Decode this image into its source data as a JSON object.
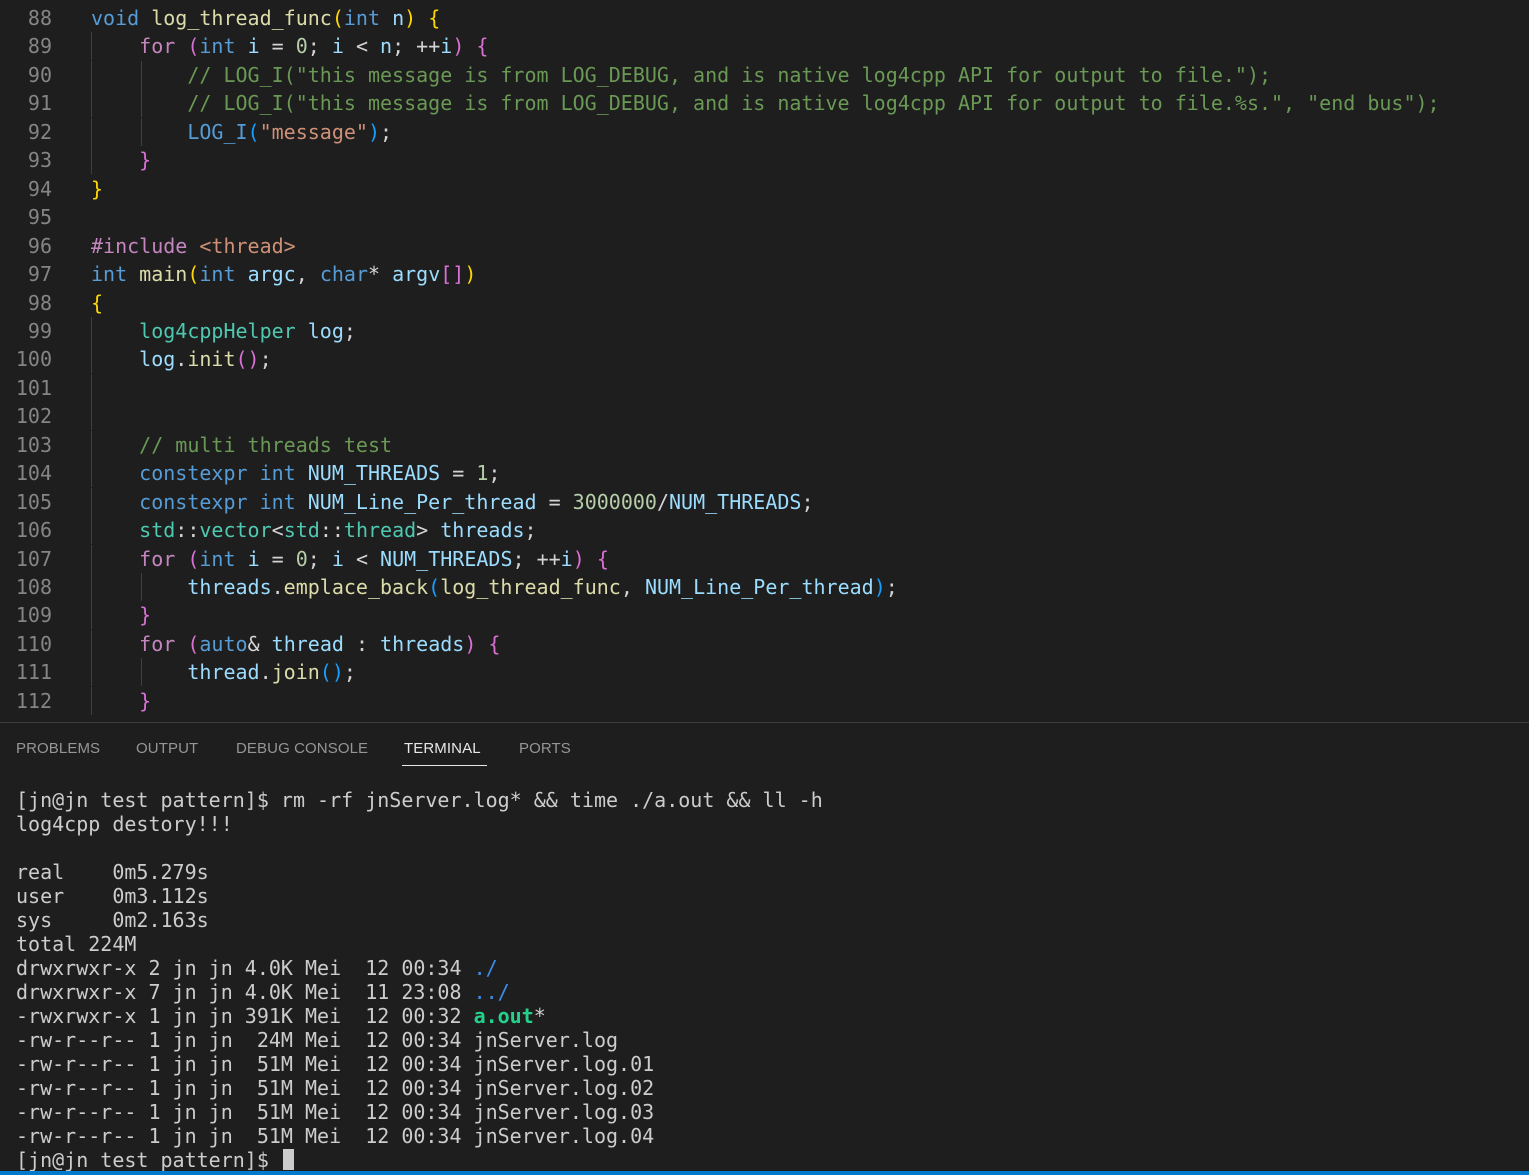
{
  "editor": {
    "lines": [
      {
        "num": "88",
        "guides": 0,
        "tokens": [
          [
            "kw",
            "void"
          ],
          [
            "op",
            " "
          ],
          [
            "fn",
            "log_thread_func"
          ],
          [
            "b1",
            "("
          ],
          [
            "kw",
            "int"
          ],
          [
            "op",
            " "
          ],
          [
            "var",
            "n"
          ],
          [
            "b1",
            ")"
          ],
          [
            "op",
            " "
          ],
          [
            "b1",
            "{"
          ]
        ]
      },
      {
        "num": "89",
        "guides": 1,
        "tokens": [
          [
            "op",
            "    "
          ],
          [
            "ctl",
            "for"
          ],
          [
            "op",
            " "
          ],
          [
            "b2",
            "("
          ],
          [
            "kw",
            "int"
          ],
          [
            "op",
            " "
          ],
          [
            "var",
            "i"
          ],
          [
            "op",
            " = "
          ],
          [
            "num",
            "0"
          ],
          [
            "op",
            "; "
          ],
          [
            "var",
            "i"
          ],
          [
            "op",
            " < "
          ],
          [
            "var",
            "n"
          ],
          [
            "op",
            "; ++"
          ],
          [
            "var",
            "i"
          ],
          [
            "b2",
            ")"
          ],
          [
            "op",
            " "
          ],
          [
            "b2",
            "{"
          ]
        ]
      },
      {
        "num": "90",
        "guides": 2,
        "tokens": [
          [
            "op",
            "        "
          ],
          [
            "cm",
            "// LOG_I(\"this message is from LOG_DEBUG, and is native log4cpp API for output to file.\");"
          ]
        ]
      },
      {
        "num": "91",
        "guides": 2,
        "tokens": [
          [
            "op",
            "        "
          ],
          [
            "cm",
            "// LOG_I(\"this message is from LOG_DEBUG, and is native log4cpp API for output to file.%s.\", \"end bus\");"
          ]
        ]
      },
      {
        "num": "92",
        "guides": 2,
        "tokens": [
          [
            "op",
            "        "
          ],
          [
            "kw",
            "LOG_I"
          ],
          [
            "b3",
            "("
          ],
          [
            "str",
            "\"message\""
          ],
          [
            "b3",
            ")"
          ],
          [
            "op",
            ";"
          ]
        ]
      },
      {
        "num": "93",
        "guides": 1,
        "tokens": [
          [
            "op",
            "    "
          ],
          [
            "b2",
            "}"
          ]
        ]
      },
      {
        "num": "94",
        "guides": 0,
        "tokens": [
          [
            "b1",
            "}"
          ]
        ]
      },
      {
        "num": "95",
        "guides": 0,
        "tokens": []
      },
      {
        "num": "96",
        "guides": 0,
        "tokens": [
          [
            "ctl",
            "#include"
          ],
          [
            "op",
            " "
          ],
          [
            "str",
            "<thread>"
          ]
        ]
      },
      {
        "num": "97",
        "guides": 0,
        "tokens": [
          [
            "kw",
            "int"
          ],
          [
            "op",
            " "
          ],
          [
            "fn",
            "main"
          ],
          [
            "b1",
            "("
          ],
          [
            "kw",
            "int"
          ],
          [
            "op",
            " "
          ],
          [
            "var",
            "argc"
          ],
          [
            "op",
            ", "
          ],
          [
            "kw",
            "char"
          ],
          [
            "op",
            "* "
          ],
          [
            "var",
            "argv"
          ],
          [
            "b2",
            "[]"
          ],
          [
            "b1",
            ")"
          ]
        ]
      },
      {
        "num": "98",
        "guides": 0,
        "tokens": [
          [
            "b1",
            "{"
          ]
        ]
      },
      {
        "num": "99",
        "guides": 1,
        "tokens": [
          [
            "op",
            "    "
          ],
          [
            "ty",
            "log4cppHelper"
          ],
          [
            "op",
            " "
          ],
          [
            "var",
            "log"
          ],
          [
            "op",
            ";"
          ]
        ]
      },
      {
        "num": "100",
        "guides": 1,
        "tokens": [
          [
            "op",
            "    "
          ],
          [
            "var",
            "log"
          ],
          [
            "op",
            "."
          ],
          [
            "fn",
            "init"
          ],
          [
            "b2",
            "()"
          ],
          [
            "op",
            ";"
          ]
        ]
      },
      {
        "num": "101",
        "guides": 1,
        "tokens": []
      },
      {
        "num": "102",
        "guides": 1,
        "tokens": []
      },
      {
        "num": "103",
        "guides": 1,
        "tokens": [
          [
            "op",
            "    "
          ],
          [
            "cm",
            "// multi threads test"
          ]
        ]
      },
      {
        "num": "104",
        "guides": 1,
        "tokens": [
          [
            "op",
            "    "
          ],
          [
            "kw",
            "constexpr"
          ],
          [
            "op",
            " "
          ],
          [
            "kw",
            "int"
          ],
          [
            "op",
            " "
          ],
          [
            "var",
            "NUM_THREADS"
          ],
          [
            "op",
            " = "
          ],
          [
            "num",
            "1"
          ],
          [
            "op",
            ";"
          ]
        ]
      },
      {
        "num": "105",
        "guides": 1,
        "tokens": [
          [
            "op",
            "    "
          ],
          [
            "kw",
            "constexpr"
          ],
          [
            "op",
            " "
          ],
          [
            "kw",
            "int"
          ],
          [
            "op",
            " "
          ],
          [
            "var",
            "NUM_Line_Per_thread"
          ],
          [
            "op",
            " = "
          ],
          [
            "num",
            "3000000"
          ],
          [
            "op",
            "/"
          ],
          [
            "var",
            "NUM_THREADS"
          ],
          [
            "op",
            ";"
          ]
        ]
      },
      {
        "num": "106",
        "guides": 1,
        "tokens": [
          [
            "op",
            "    "
          ],
          [
            "ty",
            "std"
          ],
          [
            "op",
            "::"
          ],
          [
            "ty",
            "vector"
          ],
          [
            "op",
            "<"
          ],
          [
            "ty",
            "std"
          ],
          [
            "op",
            "::"
          ],
          [
            "ty",
            "thread"
          ],
          [
            "op",
            "> "
          ],
          [
            "var",
            "threads"
          ],
          [
            "op",
            ";"
          ]
        ]
      },
      {
        "num": "107",
        "guides": 1,
        "tokens": [
          [
            "op",
            "    "
          ],
          [
            "ctl",
            "for"
          ],
          [
            "op",
            " "
          ],
          [
            "b2",
            "("
          ],
          [
            "kw",
            "int"
          ],
          [
            "op",
            " "
          ],
          [
            "var",
            "i"
          ],
          [
            "op",
            " = "
          ],
          [
            "num",
            "0"
          ],
          [
            "op",
            "; "
          ],
          [
            "var",
            "i"
          ],
          [
            "op",
            " < "
          ],
          [
            "var",
            "NUM_THREADS"
          ],
          [
            "op",
            "; ++"
          ],
          [
            "var",
            "i"
          ],
          [
            "b2",
            ")"
          ],
          [
            "op",
            " "
          ],
          [
            "b2",
            "{"
          ]
        ]
      },
      {
        "num": "108",
        "guides": 2,
        "tokens": [
          [
            "op",
            "        "
          ],
          [
            "var",
            "threads"
          ],
          [
            "op",
            "."
          ],
          [
            "fn",
            "emplace_back"
          ],
          [
            "b3",
            "("
          ],
          [
            "fn",
            "log_thread_func"
          ],
          [
            "op",
            ", "
          ],
          [
            "var",
            "NUM_Line_Per_thread"
          ],
          [
            "b3",
            ")"
          ],
          [
            "op",
            ";"
          ]
        ]
      },
      {
        "num": "109",
        "guides": 1,
        "tokens": [
          [
            "op",
            "    "
          ],
          [
            "b2",
            "}"
          ]
        ]
      },
      {
        "num": "110",
        "guides": 1,
        "tokens": [
          [
            "op",
            "    "
          ],
          [
            "ctl",
            "for"
          ],
          [
            "op",
            " "
          ],
          [
            "b2",
            "("
          ],
          [
            "kw",
            "auto"
          ],
          [
            "op",
            "& "
          ],
          [
            "var",
            "thread"
          ],
          [
            "op",
            " : "
          ],
          [
            "var",
            "threads"
          ],
          [
            "b2",
            ")"
          ],
          [
            "op",
            " "
          ],
          [
            "b2",
            "{"
          ]
        ]
      },
      {
        "num": "111",
        "guides": 2,
        "tokens": [
          [
            "op",
            "        "
          ],
          [
            "var",
            "thread"
          ],
          [
            "op",
            "."
          ],
          [
            "fn",
            "join"
          ],
          [
            "b3",
            "()"
          ],
          [
            "op",
            ";"
          ]
        ]
      },
      {
        "num": "112",
        "guides": 1,
        "tokens": [
          [
            "op",
            "    "
          ],
          [
            "b2",
            "}"
          ]
        ]
      }
    ]
  },
  "panel": {
    "tabs": [
      {
        "label": "PROBLEMS",
        "active": false
      },
      {
        "label": "OUTPUT",
        "active": false
      },
      {
        "label": "DEBUG CONSOLE",
        "active": false
      },
      {
        "label": "TERMINAL",
        "active": true
      },
      {
        "label": "PORTS",
        "active": false
      }
    ]
  },
  "terminal": {
    "lines": [
      [
        [
          "t",
          "[jn@jn test pattern]$ rm -rf jnServer.log* && time ./a.out && ll -h"
        ]
      ],
      [
        [
          "t",
          "log4cpp destory!!!"
        ]
      ],
      [
        [
          "t",
          ""
        ]
      ],
      [
        [
          "t",
          "real    0m5.279s"
        ]
      ],
      [
        [
          "t",
          "user    0m3.112s"
        ]
      ],
      [
        [
          "t",
          "sys     0m2.163s"
        ]
      ],
      [
        [
          "t",
          "total 224M"
        ]
      ],
      [
        [
          "t",
          "drwxrwxr-x 2 jn jn 4.0K Mei  12 00:34 "
        ],
        [
          "dir",
          "./"
        ]
      ],
      [
        [
          "t",
          "drwxrwxr-x 7 jn jn 4.0K Mei  11 23:08 "
        ],
        [
          "dir",
          "../"
        ]
      ],
      [
        [
          "t",
          "-rwxrwxr-x 1 jn jn 391K Mei  12 00:32 "
        ],
        [
          "exe",
          "a.out"
        ],
        [
          "t",
          "*"
        ]
      ],
      [
        [
          "t",
          "-rw-r--r-- 1 jn jn  24M Mei  12 00:34 jnServer.log"
        ]
      ],
      [
        [
          "t",
          "-rw-r--r-- 1 jn jn  51M Mei  12 00:34 jnServer.log.01"
        ]
      ],
      [
        [
          "t",
          "-rw-r--r-- 1 jn jn  51M Mei  12 00:34 jnServer.log.02"
        ]
      ],
      [
        [
          "t",
          "-rw-r--r-- 1 jn jn  51M Mei  12 00:34 jnServer.log.03"
        ]
      ],
      [
        [
          "t",
          "-rw-r--r-- 1 jn jn  51M Mei  12 00:34 jnServer.log.04"
        ]
      ]
    ],
    "prompt": "[jn@jn test pattern]$ "
  },
  "colors": {
    "editor_bg": "#1e1e1e",
    "keyword": "#569cd6",
    "control": "#c586c0",
    "function": "#dcdcaa",
    "variable": "#9cdcfe",
    "type": "#4ec9b0",
    "number": "#b5cea8",
    "string": "#ce9178",
    "comment": "#6a9955",
    "statusbar": "#007acc"
  }
}
